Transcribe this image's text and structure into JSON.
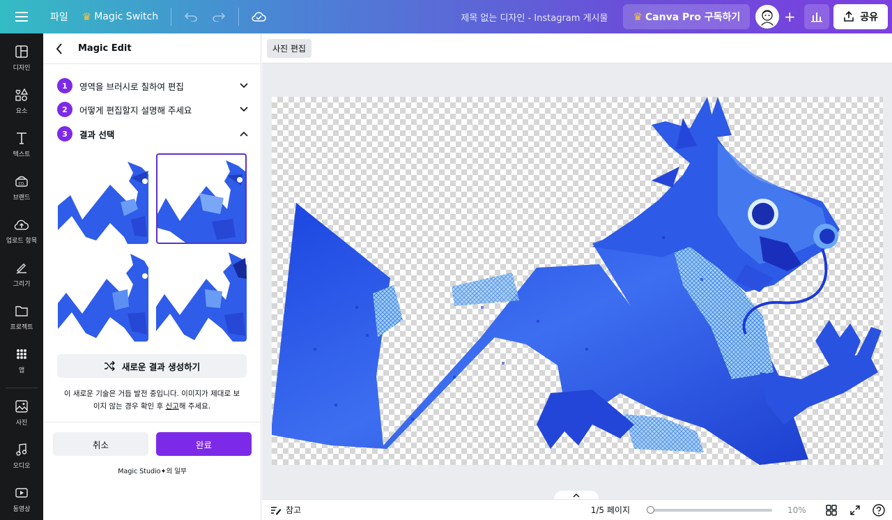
{
  "topbar": {
    "file_menu": "파일",
    "magic_switch": "Magic Switch",
    "doc_title": "제목 없는 디자인 - Instagram 게시물",
    "pro_label": "Canva Pro 구독하기",
    "share_label": "공유"
  },
  "leftnav": {
    "items": [
      {
        "label": "디자인",
        "icon": "design-icon"
      },
      {
        "label": "요소",
        "icon": "elements-icon"
      },
      {
        "label": "텍스트",
        "icon": "text-icon"
      },
      {
        "label": "브랜드",
        "icon": "brand-icon"
      },
      {
        "label": "업로드 항목",
        "icon": "upload-icon"
      },
      {
        "label": "그리기",
        "icon": "draw-icon"
      },
      {
        "label": "프로젝트",
        "icon": "folder-icon"
      },
      {
        "label": "앱",
        "icon": "apps-icon"
      },
      {
        "label": "사진",
        "icon": "photo-icon"
      },
      {
        "label": "오디오",
        "icon": "music-icon"
      },
      {
        "label": "동영상",
        "icon": "video-icon"
      }
    ]
  },
  "panel": {
    "title": "Magic Edit",
    "steps": [
      {
        "num": "1",
        "label": "영역을 브러시로 칠하여 편집"
      },
      {
        "num": "2",
        "label": "어떻게 편집할지 설명해 주세요"
      },
      {
        "num": "3",
        "label": "결과 선택"
      }
    ],
    "regenerate": "새로운 결과 생성하기",
    "notice_1": "이 새로운 기술은 거듭 발전 중입니다. 이미지가 제대로 보이지 않는 경우 확인 후 ",
    "notice_link": "신고",
    "notice_2": "해 주세요.",
    "cancel": "취소",
    "done": "완료",
    "part_of": "Magic Studio✦의 일부"
  },
  "workspace": {
    "photo_edit": "사진 편집"
  },
  "bottombar": {
    "notes": "참고",
    "page_indicator": "1/5 페이지",
    "zoom": "10%",
    "zoom_fraction": 0.0
  },
  "colors": {
    "accent": "#7d2ae8",
    "dragon": "#2f5ce8"
  }
}
